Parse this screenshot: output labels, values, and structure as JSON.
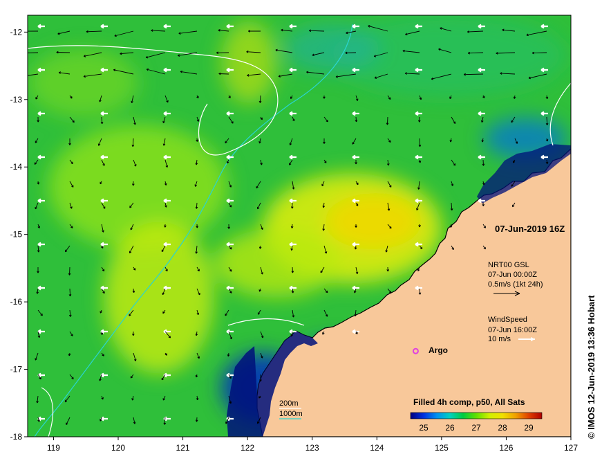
{
  "map": {
    "title_date": "07-Jun-2019 16Z",
    "credit": "© IMOS 12-Jun-2019 13:36 Hobart",
    "x_ticks": [
      "119",
      "120",
      "121",
      "122",
      "123",
      "124",
      "125",
      "126",
      "127"
    ],
    "y_ticks": [
      "-12",
      "-13",
      "-14",
      "-15",
      "-16",
      "-17",
      "-18"
    ],
    "lon_range": [
      118.6,
      127.0
    ],
    "lat_range": [
      -18.0,
      -11.75
    ],
    "current_legend": {
      "line1": "NRT00 GSL",
      "line2": "07-Jun 00:00Z",
      "line3": "0.5m/s (1kt 24h)"
    },
    "wind_legend": {
      "line1": "WindSpeed",
      "line2": "07-Jun 16:00Z",
      "line3": "10 m/s"
    },
    "argo": {
      "label": "Argo",
      "lon": 124.6,
      "lat": -16.73
    },
    "contour_legend": {
      "line1": "200m",
      "line2": "1000m"
    },
    "colorbar": {
      "title": "Filled 4h comp, p50, All Sats",
      "ticks": [
        "25",
        "26",
        "27",
        "28",
        "29"
      ],
      "range": [
        24.5,
        29.5
      ],
      "colors": [
        "#000080",
        "#0030e0",
        "#0090f0",
        "#00d0c0",
        "#00cc40",
        "#60e000",
        "#d0f000",
        "#f0e000",
        "#f0a000",
        "#e04000",
        "#b00000"
      ]
    },
    "colors": {
      "ocean": "#2fbf3a",
      "land": "#f8c89a",
      "coast": "#000000",
      "contour_200": "#ffffff",
      "contour_1000": "#2ad4d0",
      "argo": "#e040e0"
    }
  }
}
